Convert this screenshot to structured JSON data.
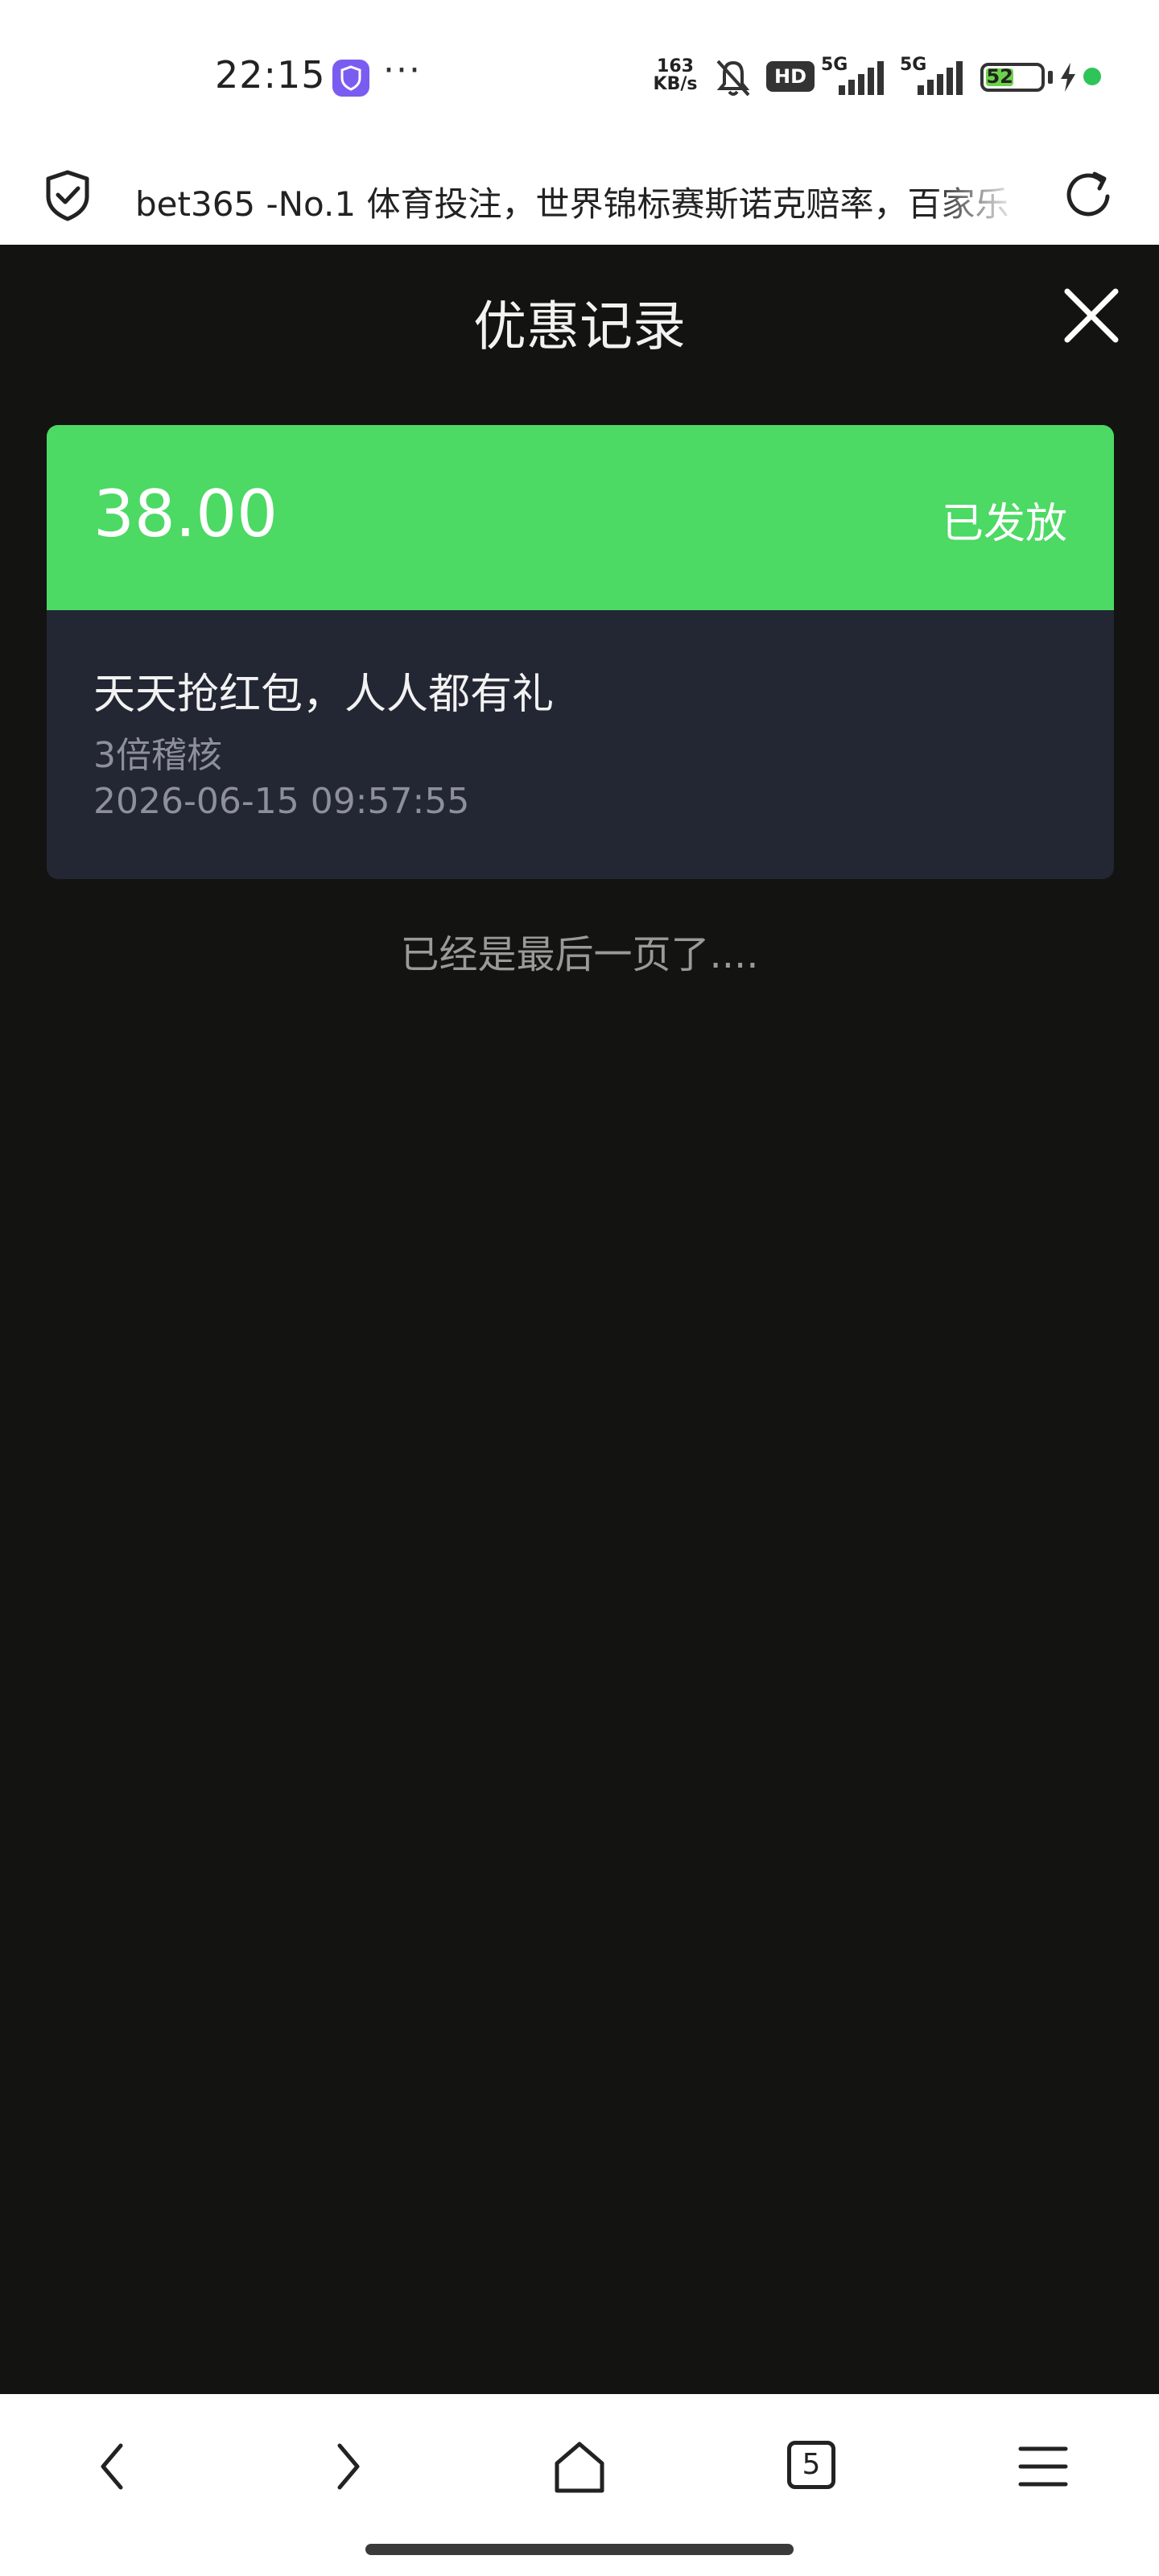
{
  "status_bar": {
    "time": "22:15",
    "more_dots": "···",
    "net_speed_value": "163",
    "net_speed_unit": "KB/s",
    "signal_1": "5G",
    "signal_2": "5G",
    "hd_label": "HD",
    "battery_level": "52",
    "battery_fraction": 0.52,
    "charge_color": "#2ec45a",
    "icons": [
      "app-shield-icon",
      "mute-bell-icon",
      "hd-icon",
      "signal-5g-icon",
      "signal-5g-icon",
      "battery-icon",
      "charging-icon"
    ]
  },
  "browser": {
    "url_title": "bet365 -No.1 体育投注，世界锦标赛斯诺克赔率，百家乐",
    "icons": [
      "shield-check-icon",
      "reload-icon"
    ]
  },
  "header": {
    "title": "优惠记录",
    "close_icon": "close-icon"
  },
  "records": [
    {
      "amount": "38.00",
      "status": "已发放",
      "title": "天天抢红包，人人都有礼",
      "subtitle": "3倍稽核",
      "time": "2026-06-15 09:57:55"
    }
  ],
  "end_text": "已经是最后一页了....",
  "bottom_nav": {
    "tab_count": "5",
    "icons": [
      "back-icon",
      "forward-icon",
      "home-icon",
      "tabs-icon",
      "menu-icon"
    ]
  },
  "colors": {
    "accent_green": "#4cd964",
    "card_bg": "#232633",
    "page_bg": "#131412"
  }
}
